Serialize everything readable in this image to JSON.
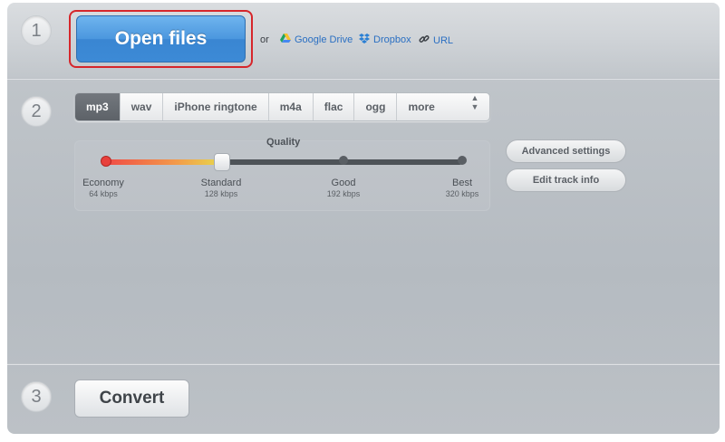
{
  "steps": {
    "one": "1",
    "two": "2",
    "three": "3"
  },
  "open_files": {
    "label": "Open files"
  },
  "sources": {
    "or_text": "or",
    "google_drive": "Google Drive",
    "dropbox": "Dropbox",
    "url": "URL",
    "icons": [
      "google-drive-icon",
      "dropbox-icon",
      "link-icon"
    ]
  },
  "formats": {
    "tabs": [
      "mp3",
      "wav",
      "iPhone ringtone",
      "m4a",
      "flac",
      "ogg",
      "more"
    ],
    "selected": "mp3"
  },
  "quality": {
    "label": "Quality",
    "selected_index": 1,
    "options": [
      {
        "name": "Economy",
        "bitrate": "64 kbps"
      },
      {
        "name": "Standard",
        "bitrate": "128 kbps"
      },
      {
        "name": "Good",
        "bitrate": "192 kbps"
      },
      {
        "name": "Best",
        "bitrate": "320 kbps"
      }
    ]
  },
  "settings": {
    "advanced": "Advanced settings",
    "edit_track": "Edit track info"
  },
  "convert": {
    "label": "Convert"
  },
  "colors": {
    "accent_blue": "#4b97de",
    "highlight_red": "#d6262b"
  }
}
